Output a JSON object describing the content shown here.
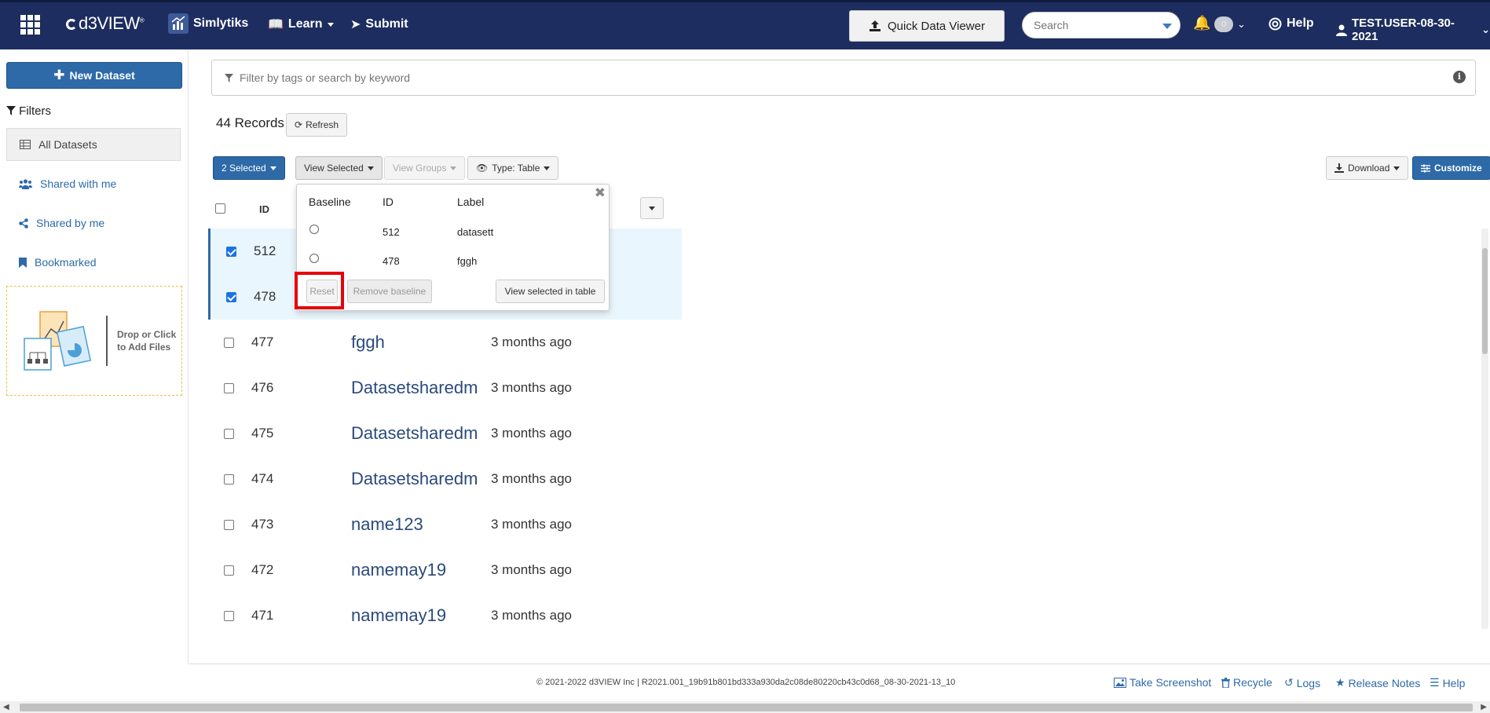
{
  "topnav": {
    "brand": "d3VIEW",
    "items": [
      {
        "label": "Simlytiks",
        "icon": "simlytiks-icon"
      },
      {
        "label": "Learn",
        "icon": "book-icon"
      },
      {
        "label": "Submit",
        "icon": "rocket-icon"
      }
    ],
    "quick_data_viewer": "Quick Data Viewer",
    "search_placeholder": "Search",
    "notifications_count": "0",
    "help": "Help",
    "user": "TEST.USER-08-30-2021"
  },
  "sidebar": {
    "new_dataset": "New Dataset",
    "filters_heading": "Filters",
    "items": [
      {
        "label": "All Datasets",
        "icon": "table-icon",
        "active": true
      },
      {
        "label": "Shared with me",
        "icon": "users-icon",
        "active": false
      },
      {
        "label": "Shared by me",
        "icon": "share-icon",
        "active": false
      },
      {
        "label": "Bookmarked",
        "icon": "bookmark-icon",
        "active": false
      }
    ],
    "dropzone_text_line1": "Drop or Click",
    "dropzone_text_line2": "to Add Files"
  },
  "main": {
    "filter_placeholder": "Filter by tags or search by keyword",
    "records": "44 Records",
    "refresh": "Refresh",
    "toolbar": {
      "selected": "2 Selected",
      "view_selected": "View Selected",
      "view_groups": "View Groups",
      "type": "Type: Table",
      "download": "Download",
      "customize": "Customize"
    },
    "table": {
      "id_header": "ID",
      "rows": [
        {
          "id": "512",
          "label": "",
          "time": "",
          "checked": true
        },
        {
          "id": "478",
          "label": "",
          "time": "",
          "checked": true
        },
        {
          "id": "477",
          "label": "fggh",
          "time": "3 months ago",
          "checked": false
        },
        {
          "id": "476",
          "label": "Datasetsharedm",
          "time": "3 months ago",
          "checked": false
        },
        {
          "id": "475",
          "label": "Datasetsharedm",
          "time": "3 months ago",
          "checked": false
        },
        {
          "id": "474",
          "label": "Datasetsharedm",
          "time": "3 months ago",
          "checked": false
        },
        {
          "id": "473",
          "label": "name123",
          "time": "3 months ago",
          "checked": false
        },
        {
          "id": "472",
          "label": "namemay19",
          "time": "3 months ago",
          "checked": false
        },
        {
          "id": "471",
          "label": "namemay19",
          "time": "3 months ago",
          "checked": false
        }
      ]
    },
    "popover": {
      "headers": {
        "baseline": "Baseline",
        "id": "ID",
        "label": "Label"
      },
      "rows": [
        {
          "id": "512",
          "label": "datasett"
        },
        {
          "id": "478",
          "label": "fggh"
        }
      ],
      "reset": "Reset",
      "remove_baseline": "Remove baseline",
      "view_in_table": "View selected in table"
    }
  },
  "footer": {
    "copyright": "© 2021-2022 d3VIEW Inc | R2021.001_19b91b801bd333a930da2c08de80220cb43c0d68_08-30-2021-13_10",
    "links": {
      "screenshot": "Take Screenshot",
      "recycle": "Recycle",
      "logs": "Logs",
      "release_notes": "Release Notes",
      "help": "Help"
    }
  },
  "colors": {
    "nav_bg": "#1d2d5f",
    "primary": "#2e6aa8",
    "selected_row": "#eaf6fd",
    "highlight": "#e8000b"
  }
}
